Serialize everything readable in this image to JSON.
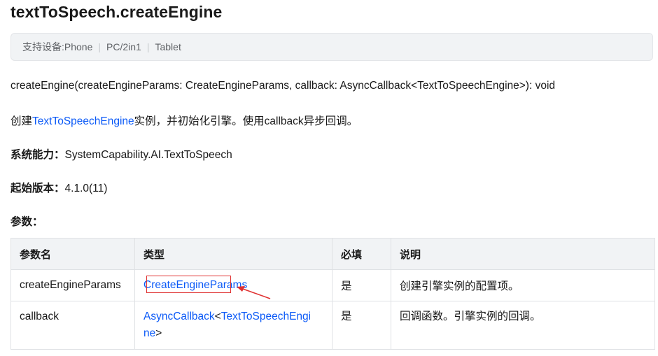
{
  "title": "textToSpeech.createEngine",
  "devices": {
    "prefix": "支持设备: ",
    "items": [
      "Phone",
      "PC/2in1",
      "Tablet"
    ]
  },
  "signature": "createEngine(createEngineParams: CreateEngineParams, callback: AsyncCallback<TextToSpeechEngine>): void",
  "description": {
    "before": "创建",
    "link": "TextToSpeechEngine",
    "after": "实例，并初始化引擎。使用callback异步回调。"
  },
  "capability": {
    "label": "系统能力：",
    "value": "SystemCapability.AI.TextToSpeech"
  },
  "since": {
    "label": "起始版本：",
    "value": "4.1.0(11)"
  },
  "params_heading": "参数：",
  "table": {
    "headers": [
      "参数名",
      "类型",
      "必填",
      "说明"
    ],
    "rows": [
      {
        "name": "createEngineParams",
        "type_link": "CreateEngineParams",
        "required": "是",
        "desc": "创建引擎实例的配置项。"
      },
      {
        "name": "callback",
        "type_link1": "AsyncCallback",
        "type_lt": "<",
        "type_link2": "TextToSpeechEngi",
        "type_link2b": "ne",
        "type_gt": ">",
        "required": "是",
        "desc": "回调函数。引擎实例的回调。"
      }
    ]
  },
  "colors": {
    "link": "#0a59f7",
    "annotation": "#e03131",
    "header_bg": "#f1f3f5"
  }
}
